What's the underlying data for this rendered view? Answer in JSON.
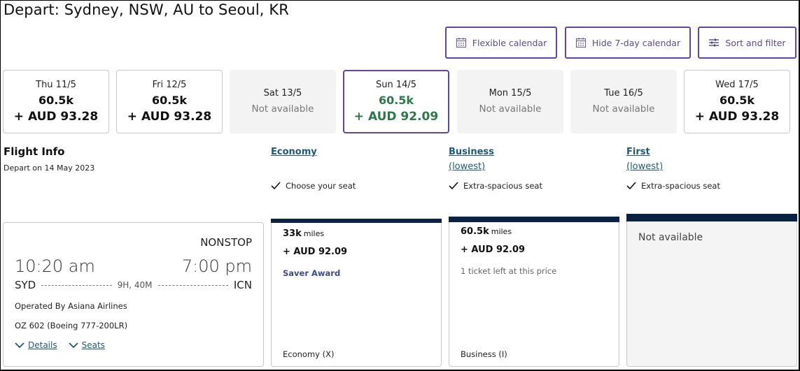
{
  "header": {
    "title": "Depart: Sydney, NSW, AU to Seoul, KR"
  },
  "toolbar": {
    "flexible_calendar": "Flexible calendar",
    "hide_calendar": "Hide 7-day calendar",
    "sort_filter": "Sort and filter"
  },
  "calendar": {
    "days": [
      {
        "date": "Thu 11/5",
        "miles": "60.5k",
        "price": "+ AUD 93.28",
        "status": "available"
      },
      {
        "date": "Fri 12/5",
        "miles": "60.5k",
        "price": "+ AUD 93.28",
        "status": "available"
      },
      {
        "date": "Sat 13/5",
        "unavailable": "Not available",
        "status": "unavailable"
      },
      {
        "date": "Sun 14/5",
        "miles": "60.5k",
        "price": "+ AUD 92.09",
        "status": "selected"
      },
      {
        "date": "Mon 15/5",
        "unavailable": "Not available",
        "status": "unavailable"
      },
      {
        "date": "Tue 16/5",
        "unavailable": "Not available",
        "status": "unavailable"
      },
      {
        "date": "Wed 17/5",
        "miles": "60.5k",
        "price": "+ AUD 93.28",
        "status": "available"
      }
    ]
  },
  "flight_info": {
    "title": "Flight Info",
    "subtitle": "Depart on 14 May 2023"
  },
  "cabins": [
    {
      "name": "Economy",
      "sub": "",
      "feature": "Choose your seat"
    },
    {
      "name": "Business",
      "sub": "(lowest)",
      "feature": "Extra-spacious seat"
    },
    {
      "name": "First",
      "sub": "(lowest)",
      "feature": "Extra-spacious seat"
    }
  ],
  "flight": {
    "stops": "NONSTOP",
    "depart_time": "10:20 am",
    "arrive_time": "7:00 pm",
    "origin": "SYD",
    "destination": "ICN",
    "duration": "9H, 40M",
    "operator": "Operated By Asiana Airlines",
    "flight_number": "OZ 602 (Boeing 777-200LR)",
    "details_link": "Details",
    "seats_link": "Seats"
  },
  "fares": {
    "economy": {
      "miles": "33k",
      "miles_unit": "miles",
      "price": "+ AUD 92.09",
      "note": "Saver Award",
      "class": "Economy (X)"
    },
    "business": {
      "miles": "60.5k",
      "miles_unit": "miles",
      "price": "+ AUD 92.09",
      "note": "1 ticket left at this price",
      "class": "Business (I)"
    },
    "first": {
      "unavailable": "Not available"
    }
  },
  "colors": {
    "accent_purple": "#6244a5",
    "selected_green": "#2a7a48",
    "link_teal": "#1d5a7a",
    "fare_bar_navy": "#0a2243"
  }
}
